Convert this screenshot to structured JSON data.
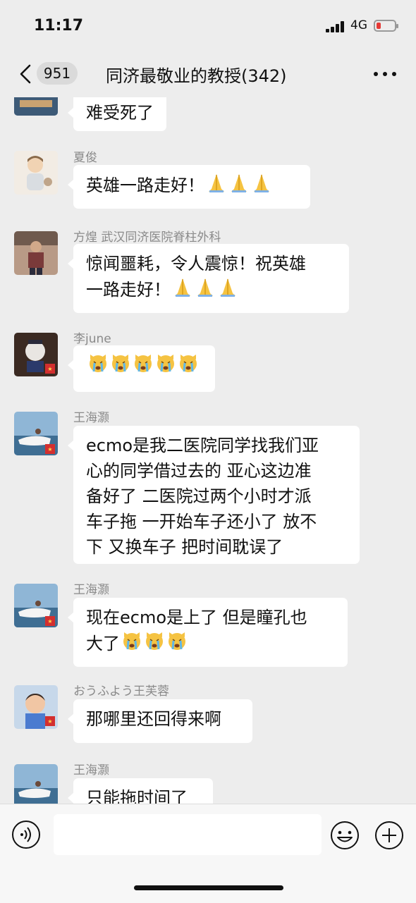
{
  "status_bar": {
    "time": "11:17",
    "network": "4G"
  },
  "header": {
    "unread_count": "951",
    "title": "同济最敬业的教授(342)"
  },
  "messages": [
    {
      "sender": "",
      "lines": [
        "难受死了"
      ],
      "emoji": []
    },
    {
      "sender": "夏俊",
      "lines": [
        "英雄一路走好！"
      ],
      "emoji": [
        "pray",
        "pray",
        "pray"
      ]
    },
    {
      "sender": "方煌  武汉同济医院脊柱外科",
      "lines": [
        "惊闻噩耗，令人震惊！祝英雄",
        "一路走好！"
      ],
      "emoji": [
        "pray",
        "pray",
        "pray"
      ]
    },
    {
      "sender": "李june",
      "lines": [
        ""
      ],
      "emoji": [
        "crying-cat",
        "crying-cat",
        "crying-cat",
        "crying-cat",
        "crying-cat"
      ]
    },
    {
      "sender": "王海灏",
      "lines": [
        "ecmo是我二医院同学找我们亚",
        "心的同学借过去的 亚心这边准",
        "备好了 二医院过两个小时才派",
        "车子拖 一开始车子还小了 放不",
        "下 又换车子 把时间耽误了"
      ],
      "emoji": []
    },
    {
      "sender": "王海灏",
      "lines": [
        "现在ecmo是上了 但是瞳孔也",
        "大了"
      ],
      "emoji": [
        "crying-cat",
        "crying-cat",
        "crying-cat"
      ]
    },
    {
      "sender": "おうふよう王芙蓉",
      "lines": [
        "那哪里还回得来啊"
      ],
      "emoji": []
    },
    {
      "sender": "王海灏",
      "lines": [
        "只能拖时间了"
      ],
      "emoji": []
    }
  ],
  "input_bar": {
    "voice_icon": "voice-icon",
    "emoji_icon": "emoji-icon",
    "plus_icon": "plus-icon"
  },
  "colors": {
    "background": "#ededed",
    "bubble": "#ffffff",
    "sender": "#8a8a8a",
    "battery_low": "#e53935"
  }
}
